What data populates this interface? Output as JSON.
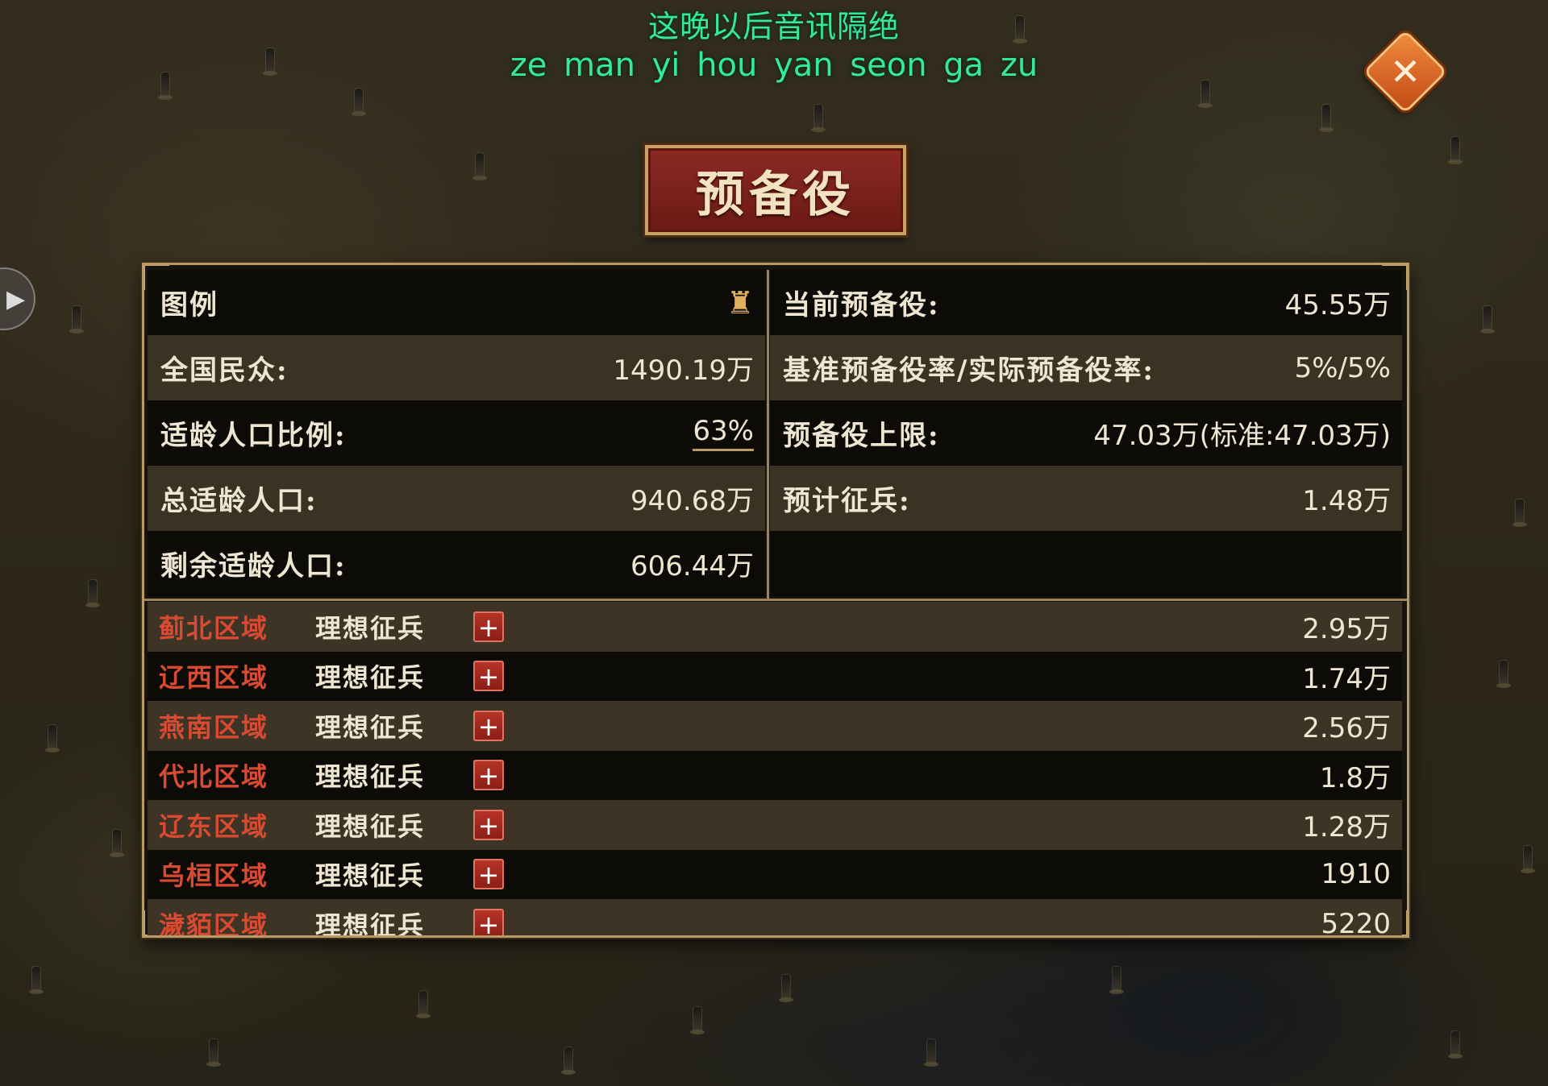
{
  "subtitle": {
    "chinese": "这晚以后音讯隔绝",
    "romanization": "ze  man  yi  hou  yan  seon  ga  zu"
  },
  "close_button": {
    "icon": "close-icon",
    "symbol": "✕"
  },
  "side_arrow": {
    "icon": "chevron-right-icon",
    "symbol": "▶"
  },
  "title": "预备役",
  "stats": {
    "left": [
      {
        "label": "图例",
        "value": "",
        "icon": "legend-figure-icon",
        "symbol": "♜"
      },
      {
        "label": "全国民众:",
        "value": "1490.19万"
      },
      {
        "label": "适龄人口比例:",
        "value": "63%"
      },
      {
        "label": "总适龄人口:",
        "value": "940.68万"
      },
      {
        "label": "剩余适龄人口:",
        "value": "606.44万"
      }
    ],
    "right": [
      {
        "label": "当前预备役:",
        "value": "45.55万"
      },
      {
        "label": "基准预备役率/实际预备役率:",
        "value": "5%/5%"
      },
      {
        "label": "预备役上限:",
        "value": "47.03万(标准:47.03万)"
      },
      {
        "label": "预计征兵:",
        "value": "1.48万"
      },
      {
        "label": "",
        "value": ""
      }
    ]
  },
  "regions": [
    {
      "name": "蓟北区域",
      "label": "理想征兵",
      "value": "2.95万"
    },
    {
      "name": "辽西区域",
      "label": "理想征兵",
      "value": "1.74万"
    },
    {
      "name": "燕南区域",
      "label": "理想征兵",
      "value": "2.56万"
    },
    {
      "name": "代北区域",
      "label": "理想征兵",
      "value": "1.8万"
    },
    {
      "name": "辽东区域",
      "label": "理想征兵",
      "value": "1.28万"
    },
    {
      "name": "乌桓区域",
      "label": "理想征兵",
      "value": "1910"
    },
    {
      "name": "濊貊区域",
      "label": "理想征兵",
      "value": "5220"
    }
  ],
  "plus_symbol": "+",
  "colors": {
    "subtitle": "#37e79a",
    "region_name": "#d84a32",
    "accent_gold": "#b99a66",
    "close_orange": "#e0742c",
    "title_red": "#7a2018"
  }
}
